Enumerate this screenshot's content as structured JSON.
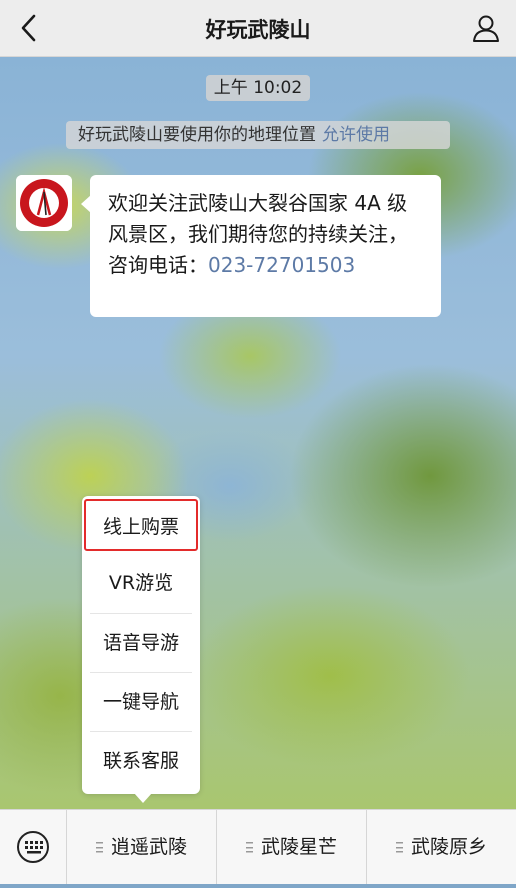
{
  "navbar": {
    "title": "好玩武陵山",
    "back_icon": "chevron-left-icon",
    "profile_icon": "person-icon"
  },
  "chat": {
    "timestamp": "上午 10:02",
    "system_notice": {
      "text": "好玩武陵山要使用你的地理位置",
      "link": "允许使用"
    },
    "message": {
      "sender_avatar": "wulingshan-logo",
      "text": "欢迎关注武陵山大裂谷国家 4A 级风景区，我们期待您的持续关注，咨询电话：",
      "phone": "023-72701503"
    }
  },
  "popup_menu": {
    "items": [
      {
        "label": "线上购票",
        "highlighted": true
      },
      {
        "label": "VR游览"
      },
      {
        "label": "语音导游"
      },
      {
        "label": "一键导航"
      },
      {
        "label": "联系客服"
      }
    ]
  },
  "bottom_bar": {
    "keyboard_icon": "keyboard-icon",
    "tabs": [
      {
        "label": "逍遥武陵"
      },
      {
        "label": "武陵星芒"
      },
      {
        "label": "武陵原乡"
      }
    ]
  },
  "colors": {
    "link": "#5d7aa6",
    "highlight_border": "#e32b2b",
    "navbar_bg": "#ededed"
  }
}
